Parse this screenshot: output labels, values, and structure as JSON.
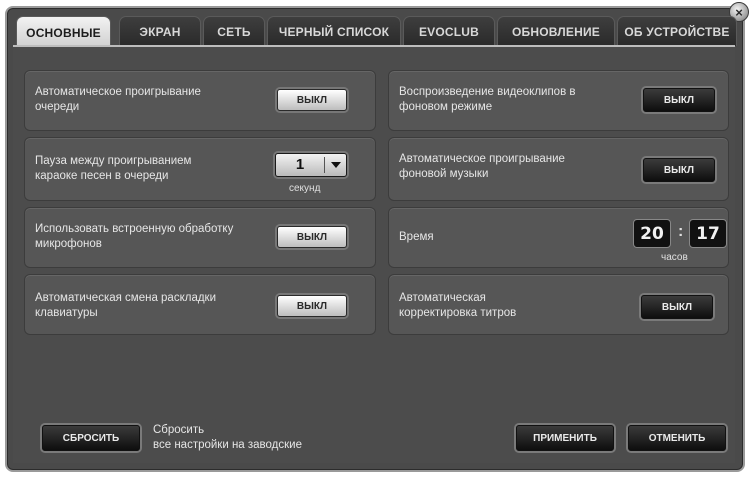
{
  "window": {
    "close_symbol": "×"
  },
  "tabs": [
    {
      "label": "ОСНОВНЫЕ",
      "active": true
    },
    {
      "label": "ЭКРАН",
      "active": false
    },
    {
      "label": "СЕТЬ",
      "active": false
    },
    {
      "label": "ЧЕРНЫЙ СПИСОК",
      "active": false
    },
    {
      "label": "EVOCLUB",
      "active": false
    },
    {
      "label": "ОБНОВЛЕНИЕ",
      "active": false
    },
    {
      "label": "ОБ УСТРОЙСТВЕ",
      "active": false
    }
  ],
  "settings": {
    "queue_autoplay": {
      "label": "Автоматическое проигрывание очереди",
      "button": "ВЫКЛ"
    },
    "karaoke_pause": {
      "label": "Пауза между проигрыванием караоке песен в очереди",
      "value": "1",
      "unit": "секунд"
    },
    "mic_processing": {
      "label": "Использовать встроенную обработку микрофонов",
      "button": "ВЫКЛ"
    },
    "layout_switch": {
      "label": "Автоматическая смена  раскладки клавиатуры",
      "button": "ВЫКЛ"
    },
    "bg_video": {
      "label": "Воспроизведение видеоклипов в фоновом режиме",
      "button": "ВЫКЛ"
    },
    "bg_music": {
      "label": "Автоматическое проигрывание фоновой музыки",
      "button": "ВЫКЛ"
    },
    "time": {
      "label": "Время",
      "hours": "20",
      "minutes": "17",
      "separator": ":",
      "unit": "часов"
    },
    "subtitle_correction": {
      "label": "Автоматическая корректировка титров",
      "button": "ВЫКЛ"
    }
  },
  "footer": {
    "reset_button": "СБРОСИТЬ",
    "reset_text_line1": "Сбросить",
    "reset_text_line2": "все настройки на заводские",
    "apply_button": "ПРИМЕНИТЬ",
    "cancel_button": "ОТМЕНИТЬ"
  },
  "icons": {
    "close": "close-icon",
    "dropdown": "chevron-down-icon"
  }
}
